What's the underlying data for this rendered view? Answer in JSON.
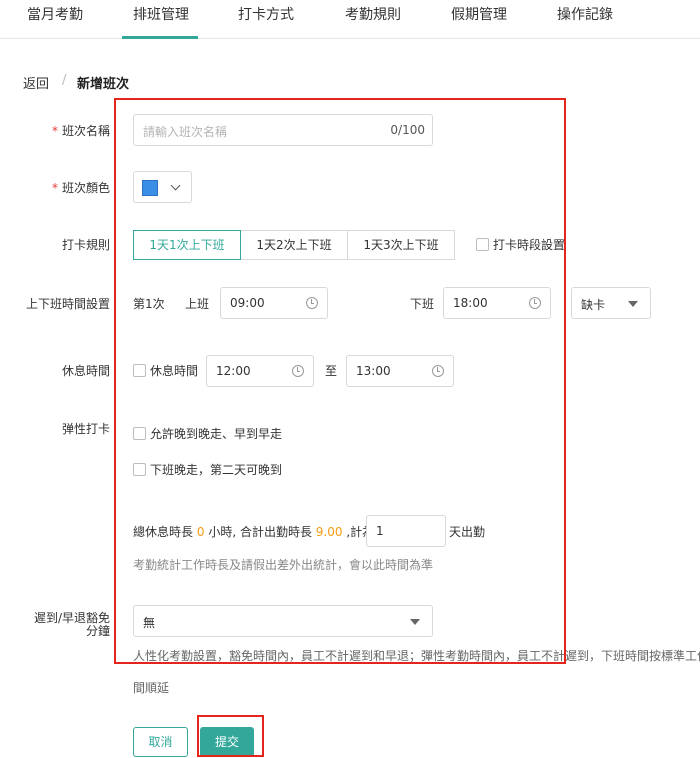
{
  "tabs": [
    {
      "label": "當月考勤"
    },
    {
      "label": "排班管理"
    },
    {
      "label": "打卡方式"
    },
    {
      "label": "考勤規則"
    },
    {
      "label": "假期管理"
    },
    {
      "label": "操作記錄"
    }
  ],
  "breadcrumb": {
    "back": "返回",
    "separator": "/",
    "current": "新增班次"
  },
  "form": {
    "required_mark": "*",
    "shift_name": {
      "label": "班次名稱",
      "placeholder": "請輸入班次名稱",
      "counter": "0/100"
    },
    "shift_color": {
      "label": "班次顏色",
      "value": "#3a8ee6"
    },
    "punch_rule": {
      "label": "打卡規則",
      "options": [
        "1天1次上下班",
        "1天2次上下班",
        "1天3次上下班"
      ],
      "selected": "1天1次上下班",
      "period_setting": "打卡時段設置"
    },
    "work_time": {
      "label": "上下班時間設置",
      "slot": "第1次",
      "on_label": "上班",
      "on_value": "09:00",
      "off_label": "下班",
      "off_value": "18:00",
      "absence_value": "缺卡"
    },
    "rest_time": {
      "label": "休息時間",
      "checkbox_label": "休息時間",
      "start": "12:00",
      "to": "至",
      "end": "13:00"
    },
    "flexible": {
      "label": "弹性打卡",
      "option1": "允許晚到晚走、早到早走",
      "option2": "下班晚走，第二天可晚到"
    },
    "summary": {
      "prefix": "總休息時長",
      "rest_hours": "0",
      "mid": "小時, 合計出勤時長",
      "work_hours": "9.00",
      "calc": ",計為",
      "days_value": "1",
      "suffix": "天出勤",
      "hint": "考勤統計工作時長及請假出差外出統計，會以此時間為準"
    },
    "late_early": {
      "label_line1": "遲到/早退豁免",
      "label_line2": "分鐘",
      "value": "無",
      "hint_line1": "人性化考勤設置，豁免時間內，員工不計遲到和早退；彈性考勤時間內，員工不計遲到，下班時間按標準工作時",
      "hint_line2": "間順延"
    }
  },
  "actions": {
    "cancel": "取消",
    "submit": "提交"
  },
  "colors": {
    "accent": "#33a89a",
    "highlight_box": "#e5251c",
    "required": "#e43b3b",
    "number": "#f39c12"
  }
}
